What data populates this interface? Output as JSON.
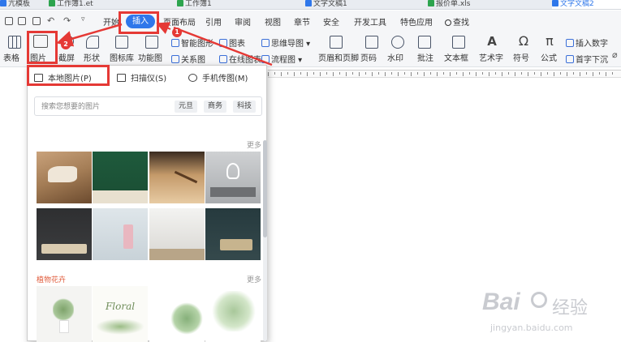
{
  "document_tabs": [
    {
      "label": "亢模板",
      "color": "#2f77ea"
    },
    {
      "label": "工作簿1.et",
      "color": "#2da44e"
    },
    {
      "label": "工作簿1",
      "color": "#2da44e"
    },
    {
      "label": "文字文稿1",
      "color": "#2f77ea"
    },
    {
      "label": "报价单.xls",
      "color": "#2da44e"
    },
    {
      "label": "文字文稿2",
      "color": "#2f77ea"
    }
  ],
  "menu": {
    "start": "开始",
    "insert": "插入",
    "page_layout": "页面布局",
    "reference": "引用",
    "review": "审阅",
    "view": "视图",
    "section": "章节",
    "security": "安全",
    "dev_tools": "开发工具",
    "special_apps": "特色应用",
    "search": "查找"
  },
  "ribbon": {
    "table": "表格",
    "picture": "图片",
    "screenshot": "截屏",
    "shape": "形状",
    "icon_library": "图标库",
    "function_chart": "功能图",
    "smart_graphic": "智能图形",
    "chart": "图表",
    "mind_map": "思维导图",
    "relation_chart": "关系图",
    "online_chart": "在线图表",
    "flowchart": "流程图",
    "header_footer": "页眉和页脚",
    "page_number": "页码",
    "watermark": "水印",
    "comment": "批注",
    "text_box": "文本框",
    "art_text": "艺术字",
    "symbol": "符号",
    "formula": "公式",
    "insert_number": "插入数字",
    "drop_cap": "首字下沉"
  },
  "dropdown": {
    "local_picture": "本地图片(P)",
    "scanner": "扫描仪(S)",
    "phone_transfer": "手机传图(M)",
    "search_placeholder": "搜索您想要的图片",
    "chips": [
      "元旦",
      "商务",
      "科技"
    ],
    "more": "更多",
    "section2_title": "植物花卉",
    "thumb_text": "Floral"
  },
  "annotations": {
    "badge1": "1",
    "badge2": "2"
  },
  "watermark": {
    "brand": "Bai",
    "brand_suffix": "经验",
    "url": "jingyan.baidu.com"
  },
  "colors": {
    "accent": "#2f77ea",
    "highlight": "#e53935",
    "section_title": "#e05c3c"
  }
}
